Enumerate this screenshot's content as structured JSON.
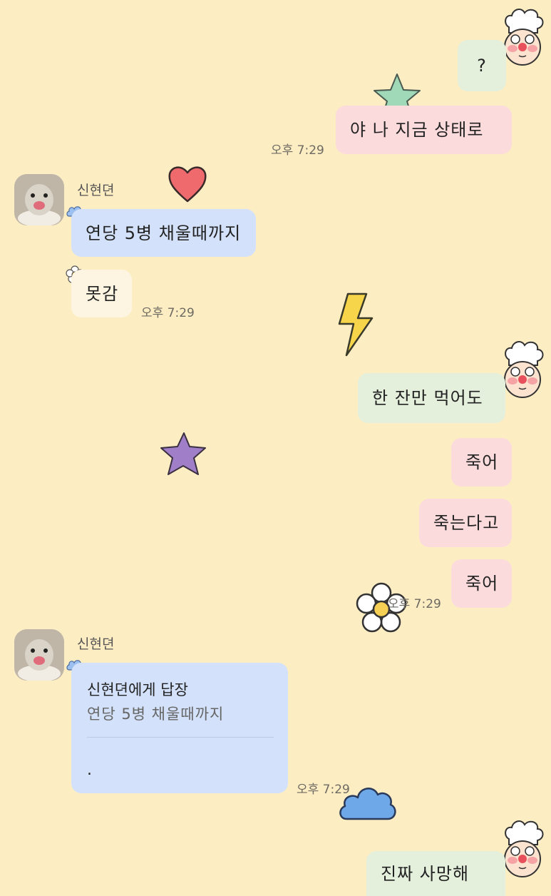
{
  "colors": {
    "background": "#fdedc3",
    "my_bubble_green": "#e4efdc",
    "my_bubble_pink": "#fbdbdc",
    "friend_bubble_blue": "#d3e1fa",
    "friend_bubble_cream": "#fdf5e2"
  },
  "sent_group_1": {
    "messages": [
      "?",
      "야 나 지금 상태로"
    ],
    "time": "오후 7:29"
  },
  "friend_group_1": {
    "name": "신현뎐",
    "messages": [
      "연당 5병 채울때까지",
      "못감"
    ],
    "time": "오후 7:29"
  },
  "sent_group_2": {
    "messages": [
      "한 잔만 먹어도",
      "죽어",
      "죽는다고",
      "죽어"
    ],
    "time": "오후 7:29"
  },
  "friend_group_2": {
    "name": "신현뎐",
    "reply": {
      "title": "신현뎐에게 답장",
      "quote": "연당 5병 채울때까지",
      "text": "."
    },
    "time": "오후 7:29"
  },
  "sent_group_3": {
    "messages": [
      "진짜 사망해"
    ]
  },
  "icons": [
    "chef-avatar-icon",
    "hamster-avatar-icon",
    "heart-sticker-icon",
    "star-sticker-icon",
    "lightning-sticker-icon",
    "flower-sticker-icon",
    "cloud-sticker-icon"
  ]
}
